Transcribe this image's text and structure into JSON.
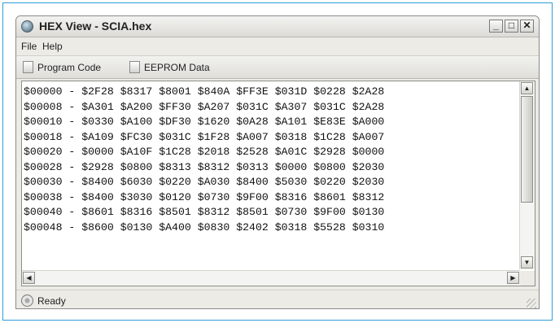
{
  "window": {
    "title": "HEX View - SCIA.hex",
    "controls": {
      "minimize": "_",
      "maximize": "□",
      "close": "✕"
    }
  },
  "menu": {
    "items": [
      {
        "label": "File"
      },
      {
        "label": "Help"
      }
    ]
  },
  "toolbar": {
    "buttons": [
      {
        "label": "Program Code",
        "icon": "document-icon"
      },
      {
        "label": "EEPROM Data",
        "icon": "document-icon"
      }
    ]
  },
  "hex_dump": {
    "rows": [
      {
        "address": "$00000",
        "words": [
          "$2F28",
          "$8317",
          "$8001",
          "$840A",
          "$FF3E",
          "$031D",
          "$0228",
          "$2A28"
        ]
      },
      {
        "address": "$00008",
        "words": [
          "$A301",
          "$A200",
          "$FF30",
          "$A207",
          "$031C",
          "$A307",
          "$031C",
          "$2A28"
        ]
      },
      {
        "address": "$00010",
        "words": [
          "$0330",
          "$A100",
          "$DF30",
          "$1620",
          "$0A28",
          "$A101",
          "$E83E",
          "$A000"
        ]
      },
      {
        "address": "$00018",
        "words": [
          "$A109",
          "$FC30",
          "$031C",
          "$1F28",
          "$A007",
          "$0318",
          "$1C28",
          "$A007"
        ]
      },
      {
        "address": "$00020",
        "words": [
          "$0000",
          "$A10F",
          "$1C28",
          "$2018",
          "$2528",
          "$A01C",
          "$2928",
          "$0000"
        ]
      },
      {
        "address": "$00028",
        "words": [
          "$2928",
          "$0800",
          "$8313",
          "$8312",
          "$0313",
          "$0000",
          "$0800",
          "$2030"
        ]
      },
      {
        "address": "$00030",
        "words": [
          "$8400",
          "$6030",
          "$0220",
          "$A030",
          "$8400",
          "$5030",
          "$0220",
          "$2030"
        ]
      },
      {
        "address": "$00038",
        "words": [
          "$8400",
          "$3030",
          "$0120",
          "$0730",
          "$9F00",
          "$8316",
          "$8601",
          "$8312"
        ]
      },
      {
        "address": "$00040",
        "words": [
          "$8601",
          "$8316",
          "$8501",
          "$8312",
          "$8501",
          "$0730",
          "$9F00",
          "$0130"
        ]
      },
      {
        "address": "$00048",
        "words": [
          "$8600",
          "$0130",
          "$A400",
          "$0830",
          "$2402",
          "$0318",
          "$5528",
          "$0310"
        ]
      }
    ]
  },
  "status": {
    "text": "Ready"
  }
}
